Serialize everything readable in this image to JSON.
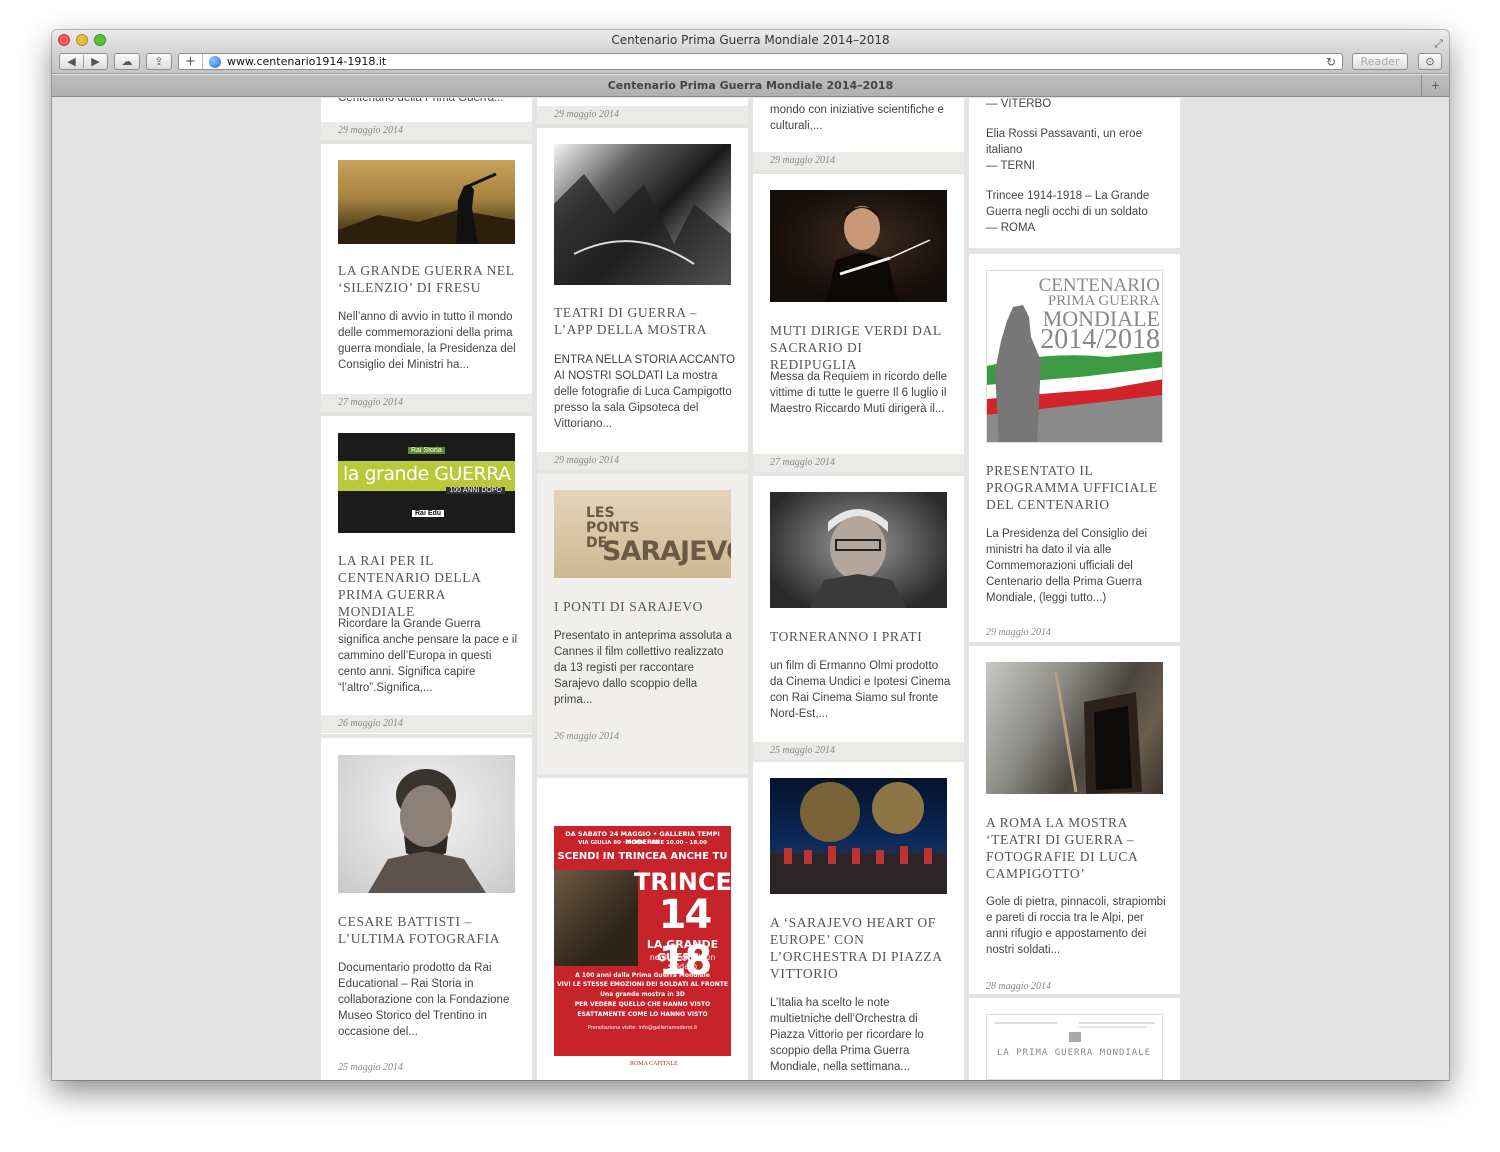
{
  "browser": {
    "window_title": "Centenario Prima Guerra Mondiale 2014–2018",
    "url": "www.centenario1914-1918.it",
    "reader_label": "Reader",
    "tab_title": "Centenario Prima Guerra Mondiale 2014–2018"
  },
  "columns": [
    {
      "cards": [
        {
          "partial_top_text": "Centenario della Prima Guerra...",
          "date": "29 maggio 2014"
        },
        {
          "title": "LA GRANDE GUERRA NEL ‘SILENZIO’ DI FRESU",
          "excerpt": "Nell’anno di avvio in tutto il mondo delle commemorazioni della prima guerra mondiale, la Presidenza del Consiglio dei Ministri ha...",
          "date": "27 maggio 2014"
        },
        {
          "title": "LA RAI PER IL CENTENARIO DELLA PRIMA GUERRA MONDIALE",
          "excerpt": "Ricordare la Grande Guerra significa anche pensare la pace e il cammino dell’Europa in questi cento anni. Significa capire “l’altro”.Significa,...",
          "date": "26 maggio 2014",
          "image_text": {
            "main": "la grande GUERRA",
            "sub": "100 ANNI DOPO",
            "tag": "Rai Storia",
            "logo": "Rai Edu"
          }
        },
        {
          "title": "CESARE BATTISTI – L’ULTIMA FOTOGRAFIA",
          "excerpt": "Documentario prodotto da Rai Educational – Rai Storia in collaborazione con la Fondazione Museo Storico del Trentino in occasione del...",
          "date": "25 maggio 2014"
        }
      ]
    },
    {
      "cards": [
        {
          "date": "29 maggio 2014"
        },
        {
          "title": "TEATRI DI GUERRA – L’APP DELLA MOSTRA",
          "excerpt": "ENTRA NELLA STORIA ACCANTO AI NOSTRI SOLDATI La mostra delle fotografie di Luca Campigotto presso la sala Gipsoteca del Vittoriano...",
          "date": "29 maggio 2014"
        },
        {
          "title": "I PONTI DI SARAJEVO",
          "excerpt": "Presentato in anteprima assoluta a Cannes il film collettivo realizzato da 13 registi per raccontare Sarajevo dallo scoppio della prima...",
          "date": "26 maggio 2014",
          "image_text": {
            "small": "LES PONTS DE",
            "big": "SARAJEVO"
          }
        },
        {
          "poster": {
            "line1": "DA SABATO 24 MAGGIO • GALLERIA TEMPI MODERNI",
            "line2": "VIA GIULIA 80 · ROMA · ORE 10.00 - 18.00",
            "line3": "SCENDI IN TRINCEA ANCHE TU",
            "big1": "TRINCEE",
            "big2": "14 18",
            "line4": "LA GRANDE GUERRA",
            "line5": "negli occhi di un soldato",
            "line6": "A 100 anni dalla Prima Guerra Mondiale",
            "line7": "VIVI LE STESSE EMOZIONI DEI SOLDATI AL FRONTE",
            "line8": "Una grande mostra in 3D",
            "line9": "PER VEDERE QUELLO CHE HANNO VISTO",
            "line10": "ESATTAMENTE COME LO HANNO VISTO",
            "line11": "Prenotazione visite: info@galleriamoderni.it",
            "footer": "ROMA CAPITALE"
          }
        }
      ]
    },
    {
      "cards": [
        {
          "partial_top_text": "mondo con iniziative scientifiche e culturali,...",
          "date": "29 maggio 2014"
        },
        {
          "title": "MUTI DIRIGE VERDI DAL SACRARIO DI REDIPUGLIA",
          "excerpt": "Messa da Requiem in ricordo delle vittime di tutte le guerre Il 6 luglio il Maestro Riccardo Muti dirigerà il...",
          "date": "27 maggio 2014"
        },
        {
          "title": "TORNERANNO I PRATI",
          "excerpt": "un film di Ermanno Olmi prodotto da Cinema Undici e Ipotesi Cinema con Rai Cinema  Siamo sul fronte Nord-Est,...",
          "date": "25 maggio 2014"
        },
        {
          "title": "A ‘SARAJEVO HEART OF EUROPE’ CON L’ORCHESTRA DI PIAZZA VITTORIO",
          "excerpt": "L’Italia ha scelto le note multietniche dell’Orchestra di Piazza Vittorio per ricordare lo scoppio della Prima Guerra Mondiale, nella settimana..."
        }
      ]
    },
    {
      "cards": [
        {
          "list_lines": [
            "— VITERBO",
            "Elia Rossi Passavanti, un eroe italiano",
            "— TERNI",
            "Trincee 1914-1918 – La Grande Guerra negli occhi di un soldato",
            "— ROMA"
          ]
        },
        {
          "title": "PRESENTATO IL PROGRAMMA UFFICIALE DEL CENTENARIO",
          "excerpt": "La Presidenza del Consiglio dei ministri ha dato il via alle Commemorazioni ufficiali del Centenario della Prima Guerra Mondiale, (leggi tutto...)",
          "date": "29 maggio 2014",
          "image_text": {
            "l1": "CENTENARIO",
            "l2": "PRIMA GUERRA",
            "l3": "MONDIALE",
            "l4": "2014/2018"
          }
        },
        {
          "title": "A ROMA LA MOSTRA ‘TEATRI DI GUERRA – FOTOGRAFIE DI LUCA CAMPIGOTTO’",
          "excerpt": "Gole di pietra, pinnacoli, strapiombi e pareti di roccia tra le Alpi, per anni rifugio e appostamento dei nostri soldati...",
          "date": "28 maggio 2014"
        },
        {
          "image_text": {
            "doc": "LA PRIMA GUERRA MONDIALE"
          }
        }
      ]
    }
  ]
}
